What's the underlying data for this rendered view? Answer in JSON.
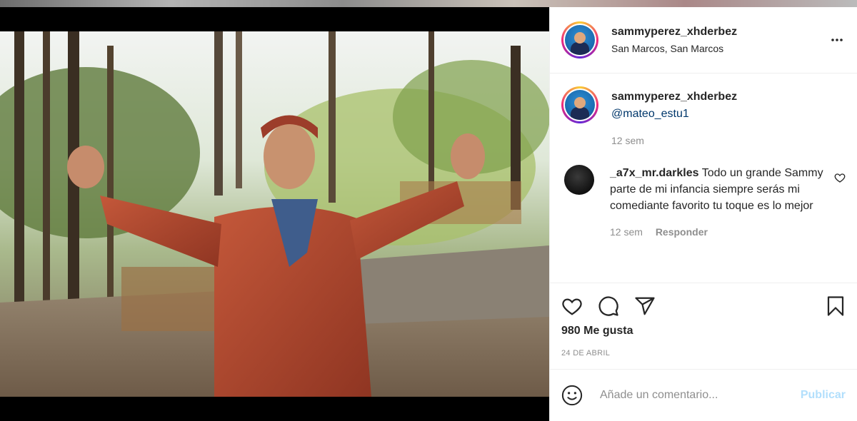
{
  "post": {
    "username": "sammyperez_xhderbez",
    "location": "San Marcos, San Marcos",
    "photo_description_icon": "photo"
  },
  "caption": {
    "username": "sammyperez_xhderbez",
    "mention": "@mateo_estu1",
    "time": "12 sem"
  },
  "comments": [
    {
      "username": "_a7x_mr.darkles",
      "text": "Todo un grande Sammy parte de mi infancia siempre serás mi comediante favorito tu toque es lo mejor",
      "time": "12 sem",
      "reply_label": "Responder"
    }
  ],
  "actions": {
    "likes": "980 Me gusta",
    "date": "24 DE ABRIL"
  },
  "add_comment": {
    "placeholder": "Añade un comentario...",
    "post_label": "Publicar"
  },
  "colors": {
    "accent_link": "#00376b",
    "post_disabled": "#b2dffc",
    "muted": "#8e8e8e"
  }
}
